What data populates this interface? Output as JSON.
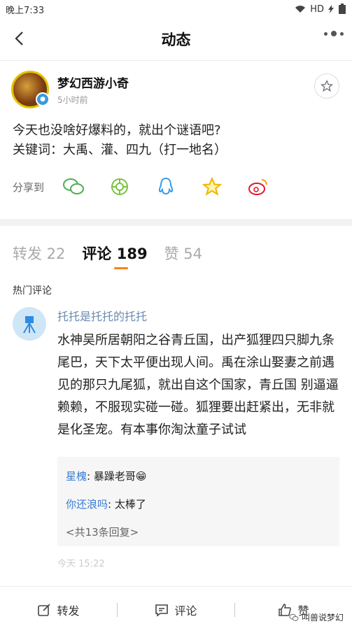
{
  "status": {
    "time": "晚上7:33",
    "network": "HD"
  },
  "header": {
    "title": "动态"
  },
  "author": {
    "name": "梦幻西游小奇",
    "time": "5小时前"
  },
  "post": {
    "line1": "今天也没啥好爆料的，就出个谜语吧?",
    "line2": "关键词：大禹、灌、四九（打一地名）"
  },
  "share": {
    "label": "分享到",
    "icons": [
      "wechat-icon",
      "moments-icon",
      "qq-icon",
      "qzone-icon",
      "weibo-icon"
    ]
  },
  "tabs": {
    "repost": "转发 22",
    "comments": "评论 189",
    "likes": "赞 54"
  },
  "section": {
    "hot": "热门评论"
  },
  "comment": {
    "name": "托托是托托的托托",
    "text": "水神吴所居朝阳之谷青丘国，出产狐狸四只脚九条尾巴，天下太平便出现人间。禹在涂山娶妻之前遇见的那只九尾狐，就出自这个国家，青丘国   别逼逼赖赖，不服现实碰一碰。狐狸要出赶紧出，无非就是化圣宠。有本事你淘汰童子试试",
    "meta": "今天 15:22",
    "replies": [
      {
        "name": "星槐",
        "text": "暴躁老哥😁"
      },
      {
        "name": "你还浪吗",
        "text": "太棒了"
      }
    ],
    "more_replies": "<共13条回复>"
  },
  "toolbar": {
    "repost": "转发",
    "comment": "评论",
    "like": "赞"
  },
  "watermark": "叫兽说梦幻",
  "colors": {
    "accent": "#ff8200",
    "link": "#3a7bd5"
  }
}
